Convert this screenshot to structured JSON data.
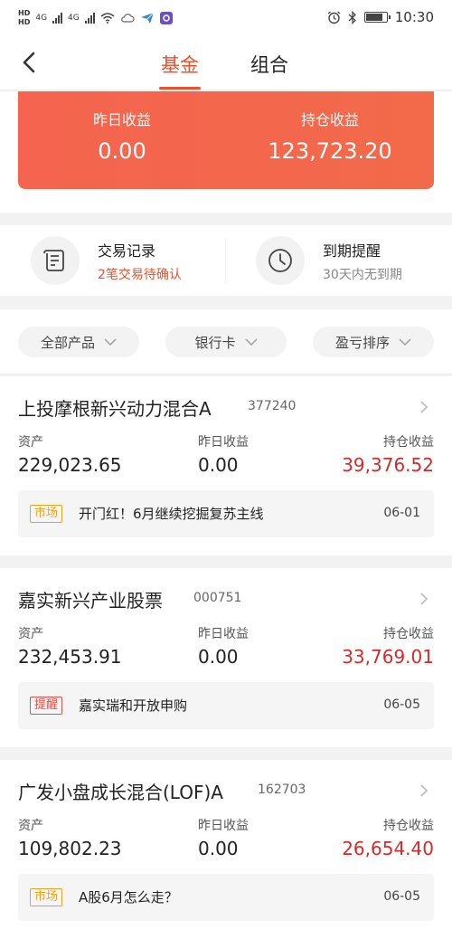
{
  "status_bar": {
    "left_labels": [
      "HD",
      "4G",
      "HD",
      "4G"
    ],
    "time": "10:30"
  },
  "header": {
    "tabs": [
      {
        "label": "基金",
        "active": true
      },
      {
        "label": "组合",
        "active": false
      }
    ]
  },
  "summary": {
    "yesterday_label": "昨日收益",
    "yesterday_value": "0.00",
    "holding_label": "持仓收益",
    "holding_value": "123,723.20"
  },
  "quick_actions": [
    {
      "title": "交易记录",
      "subtitle": "2笔交易待确认",
      "icon": "document-icon"
    },
    {
      "title": "到期提醒",
      "subtitle": "30天内无到期",
      "icon": "clock-icon"
    }
  ],
  "filters": [
    "全部产品",
    "银行卡",
    "盈亏排序"
  ],
  "column_labels": {
    "assets": "资产",
    "yesterday": "昨日收益",
    "holding": "持仓收益"
  },
  "funds": [
    {
      "name": "上投摩根新兴动力混合A",
      "code": "377240",
      "assets": "229,023.65",
      "yesterday": "0.00",
      "holding": "39,376.52",
      "news_tag": "市场",
      "news_text": "开门红！6月继续挖掘复苏主线",
      "news_date": "06-01"
    },
    {
      "name": "嘉实新兴产业股票",
      "code": "000751",
      "assets": "232,453.91",
      "yesterday": "0.00",
      "holding": "33,769.01",
      "news_tag": "提醒",
      "news_text": "嘉实瑞和开放申购",
      "news_date": "06-05"
    },
    {
      "name": "广发小盘成长混合(LOF)A",
      "code": "162703",
      "assets": "109,802.23",
      "yesterday": "0.00",
      "holding": "26,654.40",
      "news_tag": "市场",
      "news_text": "A股6月怎么走？",
      "news_date": "06-05"
    }
  ],
  "colors": {
    "accent": "#e8512a",
    "summary_bg": "#f4644f",
    "profit_red": "#d42a2a",
    "tag_market": "#e7a321",
    "tag_remind": "#e0524a"
  }
}
